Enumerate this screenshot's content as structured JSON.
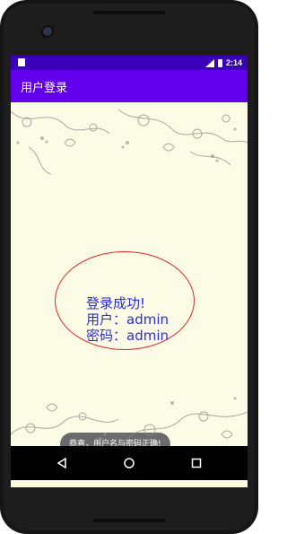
{
  "status_bar": {
    "time": "2:14",
    "colors": {
      "background": "#3a00b8"
    }
  },
  "app_bar": {
    "title": "用户登录",
    "color": "#6200ee"
  },
  "result": {
    "line1": "登录成功!",
    "line2": "用户：admin",
    "line3": "密码：admin",
    "text_color": "#2c2cd8",
    "ellipse_color": "#e0262a"
  },
  "toast": {
    "text": "恭喜，用户名与密码正确!"
  },
  "nav": {
    "back_icon": "back-triangle-icon",
    "home_icon": "home-circle-icon",
    "recent_icon": "recent-square-icon"
  }
}
